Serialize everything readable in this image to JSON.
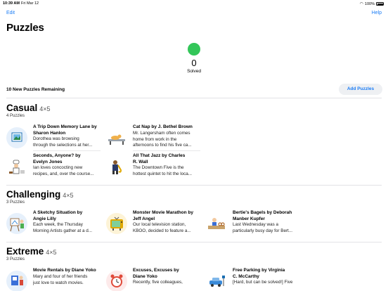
{
  "status_bar": {
    "time": "10:39 AM",
    "date": "Fri Mar 12",
    "battery": "100%"
  },
  "nav": {
    "edit": "Edit",
    "help": "Help"
  },
  "page_title": "Puzzles",
  "solved": {
    "count": "0",
    "label": "Solved",
    "color": "#33c659"
  },
  "remaining_label": "10 New Puzzles Remaining",
  "add_button": "Add Puzzles",
  "accent_color": "#1a7cf5",
  "sections": [
    {
      "name": "Casual",
      "size": "4×5",
      "count": "4 Puzzles",
      "puzzles": [
        {
          "title_lines": [
            "A Trip Down Memory Lane by",
            "Sharon Hanlon"
          ],
          "desc_lines": [
            "Dorothea was browsing",
            "through the selections at her..."
          ],
          "icon": "photo-frame-icon"
        },
        {
          "title_lines": [
            "Cat Nap by J. Bethel Brown"
          ],
          "desc_lines": [
            "Mr. Langersham often comes",
            "home from work in the",
            "afternoons to find his five ca..."
          ],
          "icon": "sleeping-cat-icon"
        },
        {
          "title_lines": [
            "Seconds, Anyone? by",
            "Evelyn Jones"
          ],
          "desc_lines": [
            "Ian loves concocting new",
            "recipes, and, over the course..."
          ],
          "icon": "chef-icon"
        },
        {
          "title_lines": [
            "All That Jazz by Charles",
            "R. Wall"
          ],
          "desc_lines": [
            "The Downtown Five is the",
            "hottest quintet to hit the loca..."
          ],
          "icon": "saxophone-player-icon"
        }
      ]
    },
    {
      "name": "Challenging",
      "size": "4×5",
      "count": "3 Puzzles",
      "puzzles": [
        {
          "title_lines": [
            "A Sketchy Situation by",
            "Angie Lilly"
          ],
          "desc_lines": [
            "Each week, the Thursday",
            "Morning Artists gather at a d..."
          ],
          "icon": "artist-easel-icon"
        },
        {
          "title_lines": [
            "Monster Movie Marathon by",
            "Jeff Angel"
          ],
          "desc_lines": [
            "Our local television station,",
            "KBOO, decided to feature a..."
          ],
          "icon": "tv-monster-icon"
        },
        {
          "title_lines": [
            "Bertie's Bagels by Deborah",
            "Manber Kupfer"
          ],
          "desc_lines": [
            "Last Wednesday was a",
            "particularly busy day for Bert..."
          ],
          "icon": "bagel-counter-icon"
        }
      ]
    },
    {
      "name": "Extreme",
      "size": "4×5",
      "count": "3 Puzzles",
      "puzzles": [
        {
          "title_lines": [
            "Movie Rentals by Diane Yoko"
          ],
          "desc_lines": [
            "Mary and four of her friends",
            "just love to watch movies."
          ],
          "icon": "movie-rental-icon"
        },
        {
          "title_lines": [
            "Excuses, Excuses by",
            "Diane Yoko"
          ],
          "desc_lines": [
            "Recently, five colleagues,"
          ],
          "icon": "alarm-clock-icon"
        },
        {
          "title_lines": [
            "Free Parking by Virginia",
            "C. McCarthy"
          ],
          "desc_lines": [
            "[Hard, but can be solved!] Five"
          ],
          "icon": "parking-car-icon"
        }
      ]
    }
  ]
}
